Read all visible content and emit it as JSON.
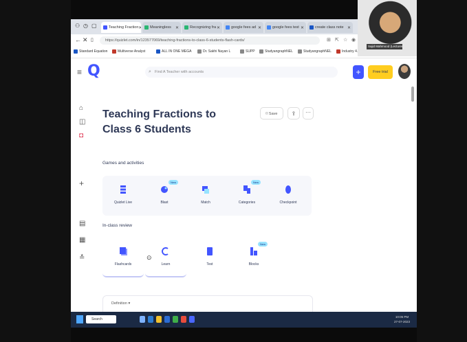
{
  "browser": {
    "tabs": [
      {
        "label": "Teaching Fraction",
        "color": "#4255ff"
      },
      {
        "label": "Meaningless",
        "color": "#2bb673"
      },
      {
        "label": "Recognizing fra",
        "color": "#2bb673"
      },
      {
        "label": "google fees ad",
        "color": "#4285f4"
      },
      {
        "label": "google fees test",
        "color": "#4285f4"
      },
      {
        "label": "create class note",
        "color": "#1a56c4"
      }
    ],
    "url": "https://quizlet.com/in/123577069/teaching-fractions-to-class-6-students-flash-cards/",
    "bookmarks": [
      "Standard Equation",
      "Multiverse Analyst",
      "ALL IN ONE MEGA",
      "Dr. Sakhi Nayan L",
      "SUPP",
      "StudyangraphNEL",
      "StudyangraphNEL",
      "Industry 4.0 - YouTu"
    ]
  },
  "app": {
    "logo": "Q",
    "search_placeholder": "Find A Teacher with accounts",
    "plus_label": "+",
    "trial_label": "Free trial"
  },
  "set": {
    "title": "Teaching Fractions to Class 6 Students",
    "save_label": "Save",
    "share_icon": "share-icon",
    "more_label": "···"
  },
  "games": {
    "heading": "Games and activities",
    "items": [
      {
        "label": "Quizlet Live",
        "badge": "",
        "color": "#4255ff"
      },
      {
        "label": "Blast",
        "badge": "New",
        "color": "#4255ff"
      },
      {
        "label": "Match",
        "badge": "",
        "color": "#4255ff"
      },
      {
        "label": "Categories",
        "badge": "New",
        "color": "#4255ff"
      },
      {
        "label": "Checkpoint",
        "badge": "",
        "color": "#4255ff"
      }
    ]
  },
  "review": {
    "heading": "In-class review",
    "items": [
      {
        "label": "Flashcards",
        "badge": ""
      },
      {
        "label": "Learn",
        "badge": ""
      },
      {
        "label": "Test",
        "badge": ""
      },
      {
        "label": "Blocks",
        "badge": "New"
      }
    ]
  },
  "definition_label": "Definition",
  "taskbar": {
    "search_label": "Search",
    "time": "10:05 PM",
    "date": "27-07-2023"
  },
  "webcam": {
    "name": "Sajid Mahmood (Lecturer)"
  }
}
